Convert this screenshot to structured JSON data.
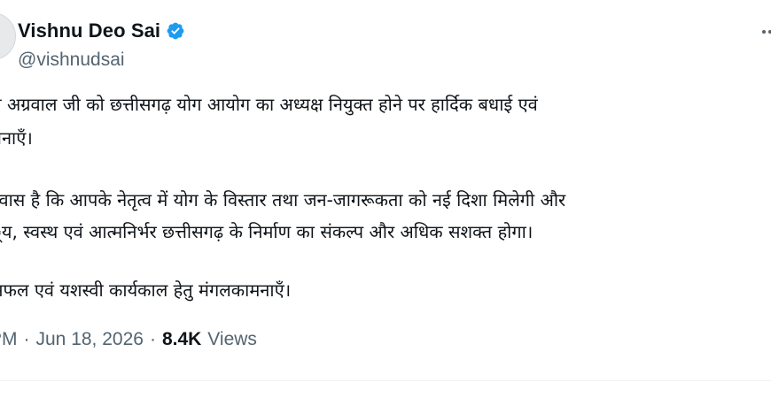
{
  "author": {
    "display_name": "Vishnu Deo Sai",
    "handle": "@vishnudsai",
    "verified": true,
    "verified_color": "#1d9bf0"
  },
  "tweet": {
    "lines": [
      "य अग्रवाल जी को छत्तीसगढ़ योग आयोग का अध्यक्ष नियुक्त होने पर हार्दिक बधाई एवं",
      "मनाएँ।",
      "श्वास है कि आपके नेतृत्व में योग के विस्तार तथा जन-जागरूकता को नई दिशा मिलेगी और",
      "्य, स्वस्थ एवं आत्मनिर्भर छत्तीसगढ़ के निर्माण का संकल्प और अधिक सशक्त होगा।",
      "सफल एवं यशस्वी कार्यकाल हेतु मंगलकामनाएँ।"
    ]
  },
  "meta": {
    "time": "PM",
    "separator": "·",
    "date": "Jun 18, 2026",
    "views_count": "8.4K",
    "views_label": "Views"
  },
  "icons": {
    "verified": "verified-badge-icon",
    "more": "more-options-icon"
  },
  "colors": {
    "text_primary": "#0f1419",
    "text_secondary": "#536471",
    "divider": "#eff3f4"
  }
}
